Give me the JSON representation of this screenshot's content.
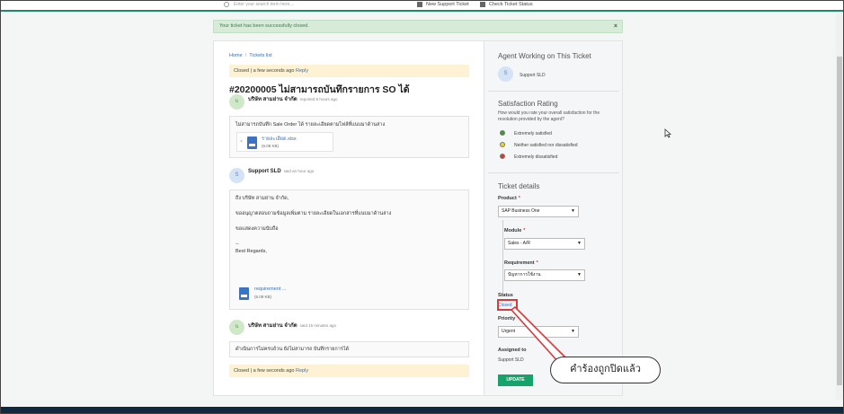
{
  "header": {
    "search_placeholder": "Enter your search term here...",
    "new_ticket": "New Support Ticket",
    "check_status": "Check Ticket Status"
  },
  "alert": {
    "message": "Your ticket has been successfully closed.",
    "close": "×"
  },
  "breadcrumb": {
    "home": "Home",
    "separator": "/",
    "tickets": "Tickets list"
  },
  "status_top": {
    "text": "Closed | a few seconds ago",
    "link": "Reply"
  },
  "ticket_title": "#20200005 ไม่สามารถบันทึกรายการ SO ได้",
  "messages": [
    {
      "avatar": "บ",
      "author": "บริษัท สามย่าน จำกัด",
      "meta": "reported 5 hours ago",
      "lines": [
        "ไม่สามารถบันทึก Sale Order ได้ รายละเอียดตามไฟล์ที่แนบมาด้านล่าง"
      ],
      "attachment": {
        "name": "รายละเอียด.xlsx",
        "size": "(6.09 KB)",
        "remove": "×"
      }
    },
    {
      "avatar": "S",
      "author": "Support SLD",
      "meta": "said an hour ago",
      "lines": [
        "ถึง บริษัท สามย่าน จำกัด,",
        "ขออนุญาตสอบถามข้อมูลเพิ่มตาม รายละเอียดในเอกสารที่แนบมาด้านล่าง",
        "ขอแสดงความนับถือ",
        "--",
        "Best Regards,"
      ],
      "attachment": {
        "name": "requirement ...",
        "size": "(6.09 KB)"
      }
    },
    {
      "avatar": "บ",
      "author": "บริษัท สามย่าน จำกัด",
      "meta": "said 15 minutes ago",
      "lines": [
        "ดำเนินการไม่ครบถ้วน ยังไม่สามารถ บันทึกรายการได้"
      ]
    }
  ],
  "status_bottom": {
    "text": "Closed | a few seconds ago",
    "link": "Reply"
  },
  "agent": {
    "title": "Agent Working on This Ticket",
    "avatar": "S",
    "name": "Support SLD"
  },
  "satisfaction": {
    "title": "Satisfaction Rating",
    "question": "How would you rate your overall satisfaction for the resolution provided by the agent?",
    "options": [
      {
        "label": "Extremely satisfied",
        "color": "#3c9a2e"
      },
      {
        "label": "Neither satisfied nor dissatisfied",
        "color": "#e6d42a"
      },
      {
        "label": "Extremely dissatisfied",
        "color": "#d93a2b"
      }
    ]
  },
  "details": {
    "title": "Ticket details",
    "product_label": "Product",
    "product_value": "SAP Business One",
    "module_label": "Module",
    "module_value": "Sales - A/R",
    "requirement_label": "Requirement",
    "requirement_value": "ปัญหาการใช้งาน",
    "required_mark": "*",
    "status_label": "Status",
    "status_value": "Closed",
    "priority_label": "Priority",
    "priority_value": "Urgent",
    "assigned_label": "Assigned to",
    "assigned_value": "Support SLD",
    "update_button": "UPDATE"
  },
  "annotation": {
    "callout_text": "คำร้องถูกปิดแล้ว",
    "highlight_color": "#d43d3d"
  },
  "colors": {
    "accent": "#16a36b",
    "link": "#3a6fb5",
    "alert_bg": "#d6ecd8",
    "status_bg": "#fdf3d4"
  }
}
